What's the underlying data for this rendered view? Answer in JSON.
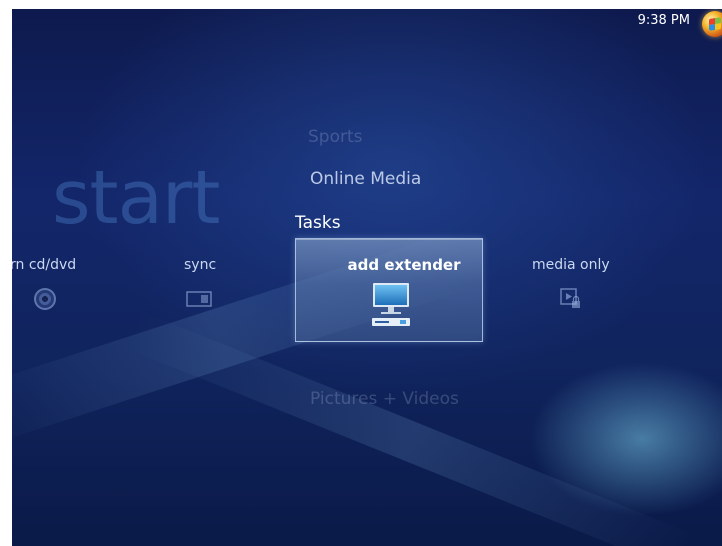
{
  "window": {
    "app": "Windows Media Center",
    "clock": "9:38 PM",
    "start_label": "start"
  },
  "menu": {
    "categories": [
      {
        "label": "Sports",
        "state": "faded"
      },
      {
        "label": "Online Media",
        "state": "adjacent"
      },
      {
        "label": "Tasks",
        "state": "active"
      },
      {
        "label": "Pictures + Videos",
        "state": "faded"
      }
    ],
    "task_items": [
      {
        "label": "rn cd/dvd",
        "icon": "disc-icon"
      },
      {
        "label": "sync",
        "icon": "sync-icon"
      },
      {
        "label": "add extender",
        "icon": "monitor-icon",
        "selected": true
      },
      {
        "label": "media only",
        "icon": "media-lock-icon"
      }
    ]
  },
  "colors": {
    "background": "#13266a",
    "accent_glow": "#78c8e6",
    "text_active": "#ffffff",
    "text_dim": "#c9d8f2"
  }
}
